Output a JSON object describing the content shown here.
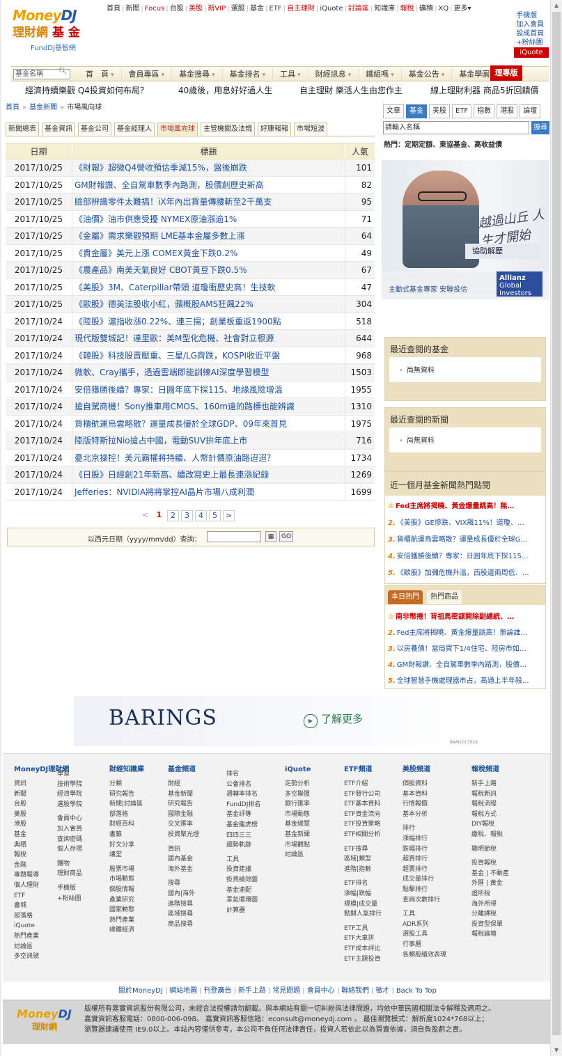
{
  "topnav": [
    {
      "label": "首頁"
    },
    {
      "label": "新聞"
    },
    {
      "label": "Focus",
      "hot": true
    },
    {
      "label": "台股"
    },
    {
      "label": "美股",
      "hot": true
    },
    {
      "label": "新VIP",
      "hot": true
    },
    {
      "label": "選股"
    },
    {
      "label": "基金"
    },
    {
      "label": "ETF"
    },
    {
      "label": "自主理財",
      "hot": true
    },
    {
      "label": "iQuote"
    },
    {
      "label": "討論區",
      "hot": true
    },
    {
      "label": "知識庫"
    },
    {
      "label": "報稅",
      "hot": true
    },
    {
      "label": "礦積"
    },
    {
      "label": "XQ"
    },
    {
      "label": "更多▾"
    }
  ],
  "logo": {
    "brand_a": "Money",
    "brand_b": "DJ",
    "line2": "理財網",
    "line2b": "基 金",
    "sub": "FundDJ基智網"
  },
  "right_links": [
    "手機版",
    "加入會員",
    "設成首頁",
    "+粉絲團"
  ],
  "iquote_button": "iQuote",
  "mainnav": {
    "search_placeholder": "基金名稱",
    "items": [
      "首　頁",
      "會員專區",
      "基金搜尋",
      "基金排名",
      "工具",
      "財經訊息",
      "鐵組嗎",
      "基金公告",
      "基金學園"
    ],
    "highlight": "理專版"
  },
  "promos": [
    {
      "text": "經濟持續樂觀 Q4投資如何布局？"
    },
    {
      "text": "40歲後，用息好好過人生"
    },
    {
      "text": "自主理財 樂活人生由您作主"
    },
    {
      "text": "線上理財利器 商品5折回饋價"
    }
  ],
  "breadcrumb": {
    "home": "首頁",
    "section": "基金新聞",
    "current": "市場風向球"
  },
  "tabs": [
    "新聞總表",
    "基金資訊",
    "基金公司",
    "基金經理人",
    "市場風向球",
    "主管機關及法規",
    "好康報報",
    "市場短波"
  ],
  "active_tab": "市場風向球",
  "table": {
    "headers": {
      "date": "日期",
      "title": "標題",
      "views": "人氣"
    },
    "rows": [
      {
        "date": "2017/10/25",
        "title": "《財報》超微Q4營收預估季減15%，盤後崩跌",
        "views": "101"
      },
      {
        "date": "2017/10/25",
        "title": "GM財報讚、全自駕車數季內路測，股價創歷史新高",
        "views": "82"
      },
      {
        "date": "2017/10/25",
        "title": "臉部辨識零件太難搞！iX年內出貨量傳腰斬至2千萬支",
        "views": "95"
      },
      {
        "date": "2017/10/25",
        "title": "《油價》油市供應受擾 NYMEX原油漲逾1%",
        "views": "71"
      },
      {
        "date": "2017/10/25",
        "title": "《金屬》需求樂觀預期 LME基本金屬多數上漲",
        "views": "64"
      },
      {
        "date": "2017/10/25",
        "title": "《貴金屬》美元上漲 COMEX黃金下跌0.2%",
        "views": "49"
      },
      {
        "date": "2017/10/25",
        "title": "《農產品》南美天氣良好 CBOT黃豆下跌0.5%",
        "views": "67"
      },
      {
        "date": "2017/10/25",
        "title": "《美股》3M、Caterpillar帶頭 道瓊衝歷史高！生技軟",
        "views": "47"
      },
      {
        "date": "2017/10/25",
        "title": "《歐股》德英法股收小紅，蘋概股AMS狂飆22%",
        "views": "304"
      },
      {
        "date": "2017/10/24",
        "title": "《陸股》滬指收漲0.22%、連三揚；創業板重返1900點",
        "views": "518"
      },
      {
        "date": "2017/10/24",
        "title": "現代版雙城記！達里歐：美M型化危機、社會對立根源",
        "views": "644"
      },
      {
        "date": "2017/10/24",
        "title": "《韓股》科技股賣壓重、三星/LG齊跌，KOSPI收近平盤",
        "views": "968"
      },
      {
        "date": "2017/10/24",
        "title": "微軟、Cray攜手，透過雲端即能訓練AI深度學習模型",
        "views": "1503"
      },
      {
        "date": "2017/10/24",
        "title": "安倍獲勝後續？專家：日圓年底下探115、地緣風險增溫",
        "views": "1955"
      },
      {
        "date": "2017/10/24",
        "title": "搶自駕商機！Sony推車用CMOS、160m遠的路標也能辨識",
        "views": "1310"
      },
      {
        "date": "2017/10/24",
        "title": "貨櫃航運烏雲略散？運量成長優於全球GDP、09年來首見",
        "views": "1975"
      },
      {
        "date": "2017/10/24",
        "title": "陸版特斯拉Nio搶占中國，電動SUV拚年底上市",
        "views": "716"
      },
      {
        "date": "2017/10/24",
        "title": "憂北京操控！美元霸權將持續、人幣計價原油路迢迢？",
        "views": "1734"
      },
      {
        "date": "2017/10/24",
        "title": "《日股》日經創21年新高、續改寫史上最長連漲紀錄",
        "views": "1269"
      },
      {
        "date": "2017/10/24",
        "title": "Jefferies：NVIDIA將將掌控AI晶片市場八成利潤",
        "views": "1699"
      }
    ]
  },
  "pager": {
    "prev": "<",
    "pages": [
      "1",
      "2",
      "3",
      "4",
      "5"
    ],
    "current": "1",
    "next": ">"
  },
  "date_search": {
    "label": "以西元日期（yyyy/mm/dd）查詢：",
    "go": "GO"
  },
  "right": {
    "tabs": [
      "文章",
      "基金",
      "美股",
      "ETF",
      "指數",
      "港股",
      "論壇"
    ],
    "active_tab": "基金",
    "search_placeholder": "請輸入名稱",
    "search_button": "搜尋",
    "hot": "熱門：定期定額、東協基金、高收益債",
    "ad": {
      "cta": "協助解歷",
      "script": "越過山丘 人生才開始",
      "tagline": "主動式基金專家 安聯投信",
      "brand": "Allianz",
      "brand_sub": "Global Investors"
    },
    "recent_funds": {
      "title": "最近查閱的基金",
      "empty": "尚無資料"
    },
    "recent_news": {
      "title": "最近查閱的新聞",
      "empty": "尚無資料"
    },
    "hot_month": {
      "title": "近一個月基金新聞熱門點閱",
      "items": [
        {
          "n": "",
          "text": "Fed主席將揭曉、黃金爆量跳高！無…",
          "top": true
        },
        {
          "n": "2.",
          "text": "《美股》GE慘跌、VIX飆11%！道瓊、…"
        },
        {
          "n": "3.",
          "text": "貨櫃航運烏雲略散？運量成長優於全球G…"
        },
        {
          "n": "4.",
          "text": "安倍獲勝後續？專家：日圓年底下探115…"
        },
        {
          "n": "5.",
          "text": "《歐股》加彌危機升溫，西股邊兩周低、…"
        }
      ]
    },
    "today": {
      "tab_on": "本日熱門",
      "tab_off": "熱門商品",
      "items": [
        {
          "n": "",
          "text": "南非幣捲！背祖馬密謀開除副總統、…",
          "top": true
        },
        {
          "n": "2.",
          "text": "Fed主席將揭曉、黃金爆量跳高！無論誰…"
        },
        {
          "n": "3.",
          "text": "以房養債！當局買下1/4住宅、陸房市如…"
        },
        {
          "n": "4.",
          "text": "GM財報讚、全自駕車數季內路測，股價…"
        },
        {
          "n": "5.",
          "text": "全球智慧手機處理器市占，高通上半年殺…"
        }
      ]
    }
  },
  "barings_ad": {
    "brand": "BARINGS",
    "cta": "了解更多",
    "code": "BAM2017029"
  },
  "footer": {
    "columns": [
      {
        "title": "MoneyDJ理財網",
        "lines": [
          "資訊",
          "新聞",
          "台股",
          "美股",
          "港股",
          "基金",
          "典積",
          "報稅",
          "金融",
          "專題報導",
          "個人理財",
          "ETF",
          "書城",
          "部落格",
          "iQuote",
          "熱門產業",
          "討論區",
          "多空訊號"
        ]
      },
      {
        "title": "",
        "lines": [
          "學習",
          "技術學院",
          "經濟學院",
          "選股學院",
          "",
          "會員中心",
          "加入會員",
          "查詢密碼",
          "個人存摺",
          "",
          "購物",
          "理財商品",
          "",
          "手機版",
          "+粉絲團"
        ]
      },
      {
        "title": "財經知識庫",
        "lines": [
          "分類",
          "研究報告",
          "新聞|討論區",
          "部落格",
          "財經百科",
          "書籤",
          "好文分享",
          "講堂",
          "",
          "股票市場",
          "市場動態",
          "個股情報",
          "產業研究",
          "國家動態",
          "熱門產業",
          "總體經濟"
        ]
      },
      {
        "title": "基金頻道",
        "lines": [
          "財經",
          "基金新聞",
          "研究報告",
          "國際金融",
          "交叉匯率",
          "投資聚光燈",
          "",
          "資訊",
          "國內基金",
          "海外基金",
          "",
          "搜尋",
          "國內|海外",
          "進階搜尋",
          "區域搜尋",
          "商品搜尋"
        ]
      },
      {
        "title": "",
        "lines": [
          "排名",
          "公會排名",
          "週轉率排名",
          "FundDJ排名",
          "基金評等",
          "基金龍虎榜",
          "四四三三",
          "趨勢軌跡",
          "",
          "工具",
          "投資建議",
          "投資績效圖",
          "基金速配",
          "景氣循環圖",
          "計算器"
        ]
      },
      {
        "title": "iQuote",
        "lines": [
          "走勢分析",
          "多空聯盟",
          "銀行匯率",
          "市場動態",
          "基金總覽",
          "基金新聞",
          "市場觀點",
          "討論區"
        ]
      },
      {
        "title": "ETF頻道",
        "lines": [
          "ETF介紹",
          "ETF發行公司",
          "ETF基本資料",
          "ETF資金流向",
          "ETF投資策略",
          "ETF相關分析",
          "",
          "ETF搜尋",
          "區域|類型",
          "進階|指數",
          "",
          "ETF排名",
          "漲幅|跌幅",
          "規模|成交量",
          "點閱人氣排行",
          "",
          "ETF工具",
          "ETF大車拼",
          "ETF成本評比",
          "ETF主題投資"
        ]
      },
      {
        "title": "美股頻道",
        "lines": [
          "個股資料",
          "基本資料",
          "行情報價",
          "基本分析",
          "",
          "排行",
          "漲幅排行",
          "跌幅排行",
          "超買排行",
          "超賣排行",
          "成交量排行",
          "點擊排行",
          "查詢次數排行",
          "",
          "工具",
          "ADR系列",
          "選股工具",
          "行事曆",
          "各類股績效表現"
        ]
      },
      {
        "title": "報稅頻道",
        "lines": [
          "新手上路",
          "報稅新訊",
          "報稅流程",
          "報稅方式",
          "DIY報稅",
          "繳稅、報稅",
          "",
          "聰明節稅",
          "",
          "投資報稅",
          "基金 | 不動產",
          "外匯 | 黃金",
          "證所稅",
          "海外所得",
          "分離課稅",
          "投資型保單",
          "報稅論壇"
        ]
      }
    ],
    "links": [
      "關於MoneyDJ",
      "網站地圖",
      "刊登廣告",
      "新手上路",
      "常見問題",
      "會員中心",
      "聯絡我們",
      "徵才",
      "Back To Top"
    ],
    "copyright": [
      "版權所有嘉實資訊股份有限公司，未經合法授權請勿翻載。與本網站有關一切糾紛與法律問題，均依中華民國相關法令解釋及適用之。",
      "嘉實資訊客服電話：0800-006-098。 嘉實資訊客服信箱：econsult@moneydj.com 。 最佳瀏覽模式：解析度1024*768以上；",
      "瀏覽器建議使用 IE9.0以上。本站內容僅供參考，本公司不負任何法律責任，投資人若依此以為買賣依據，須自負盈虧之責。"
    ]
  }
}
